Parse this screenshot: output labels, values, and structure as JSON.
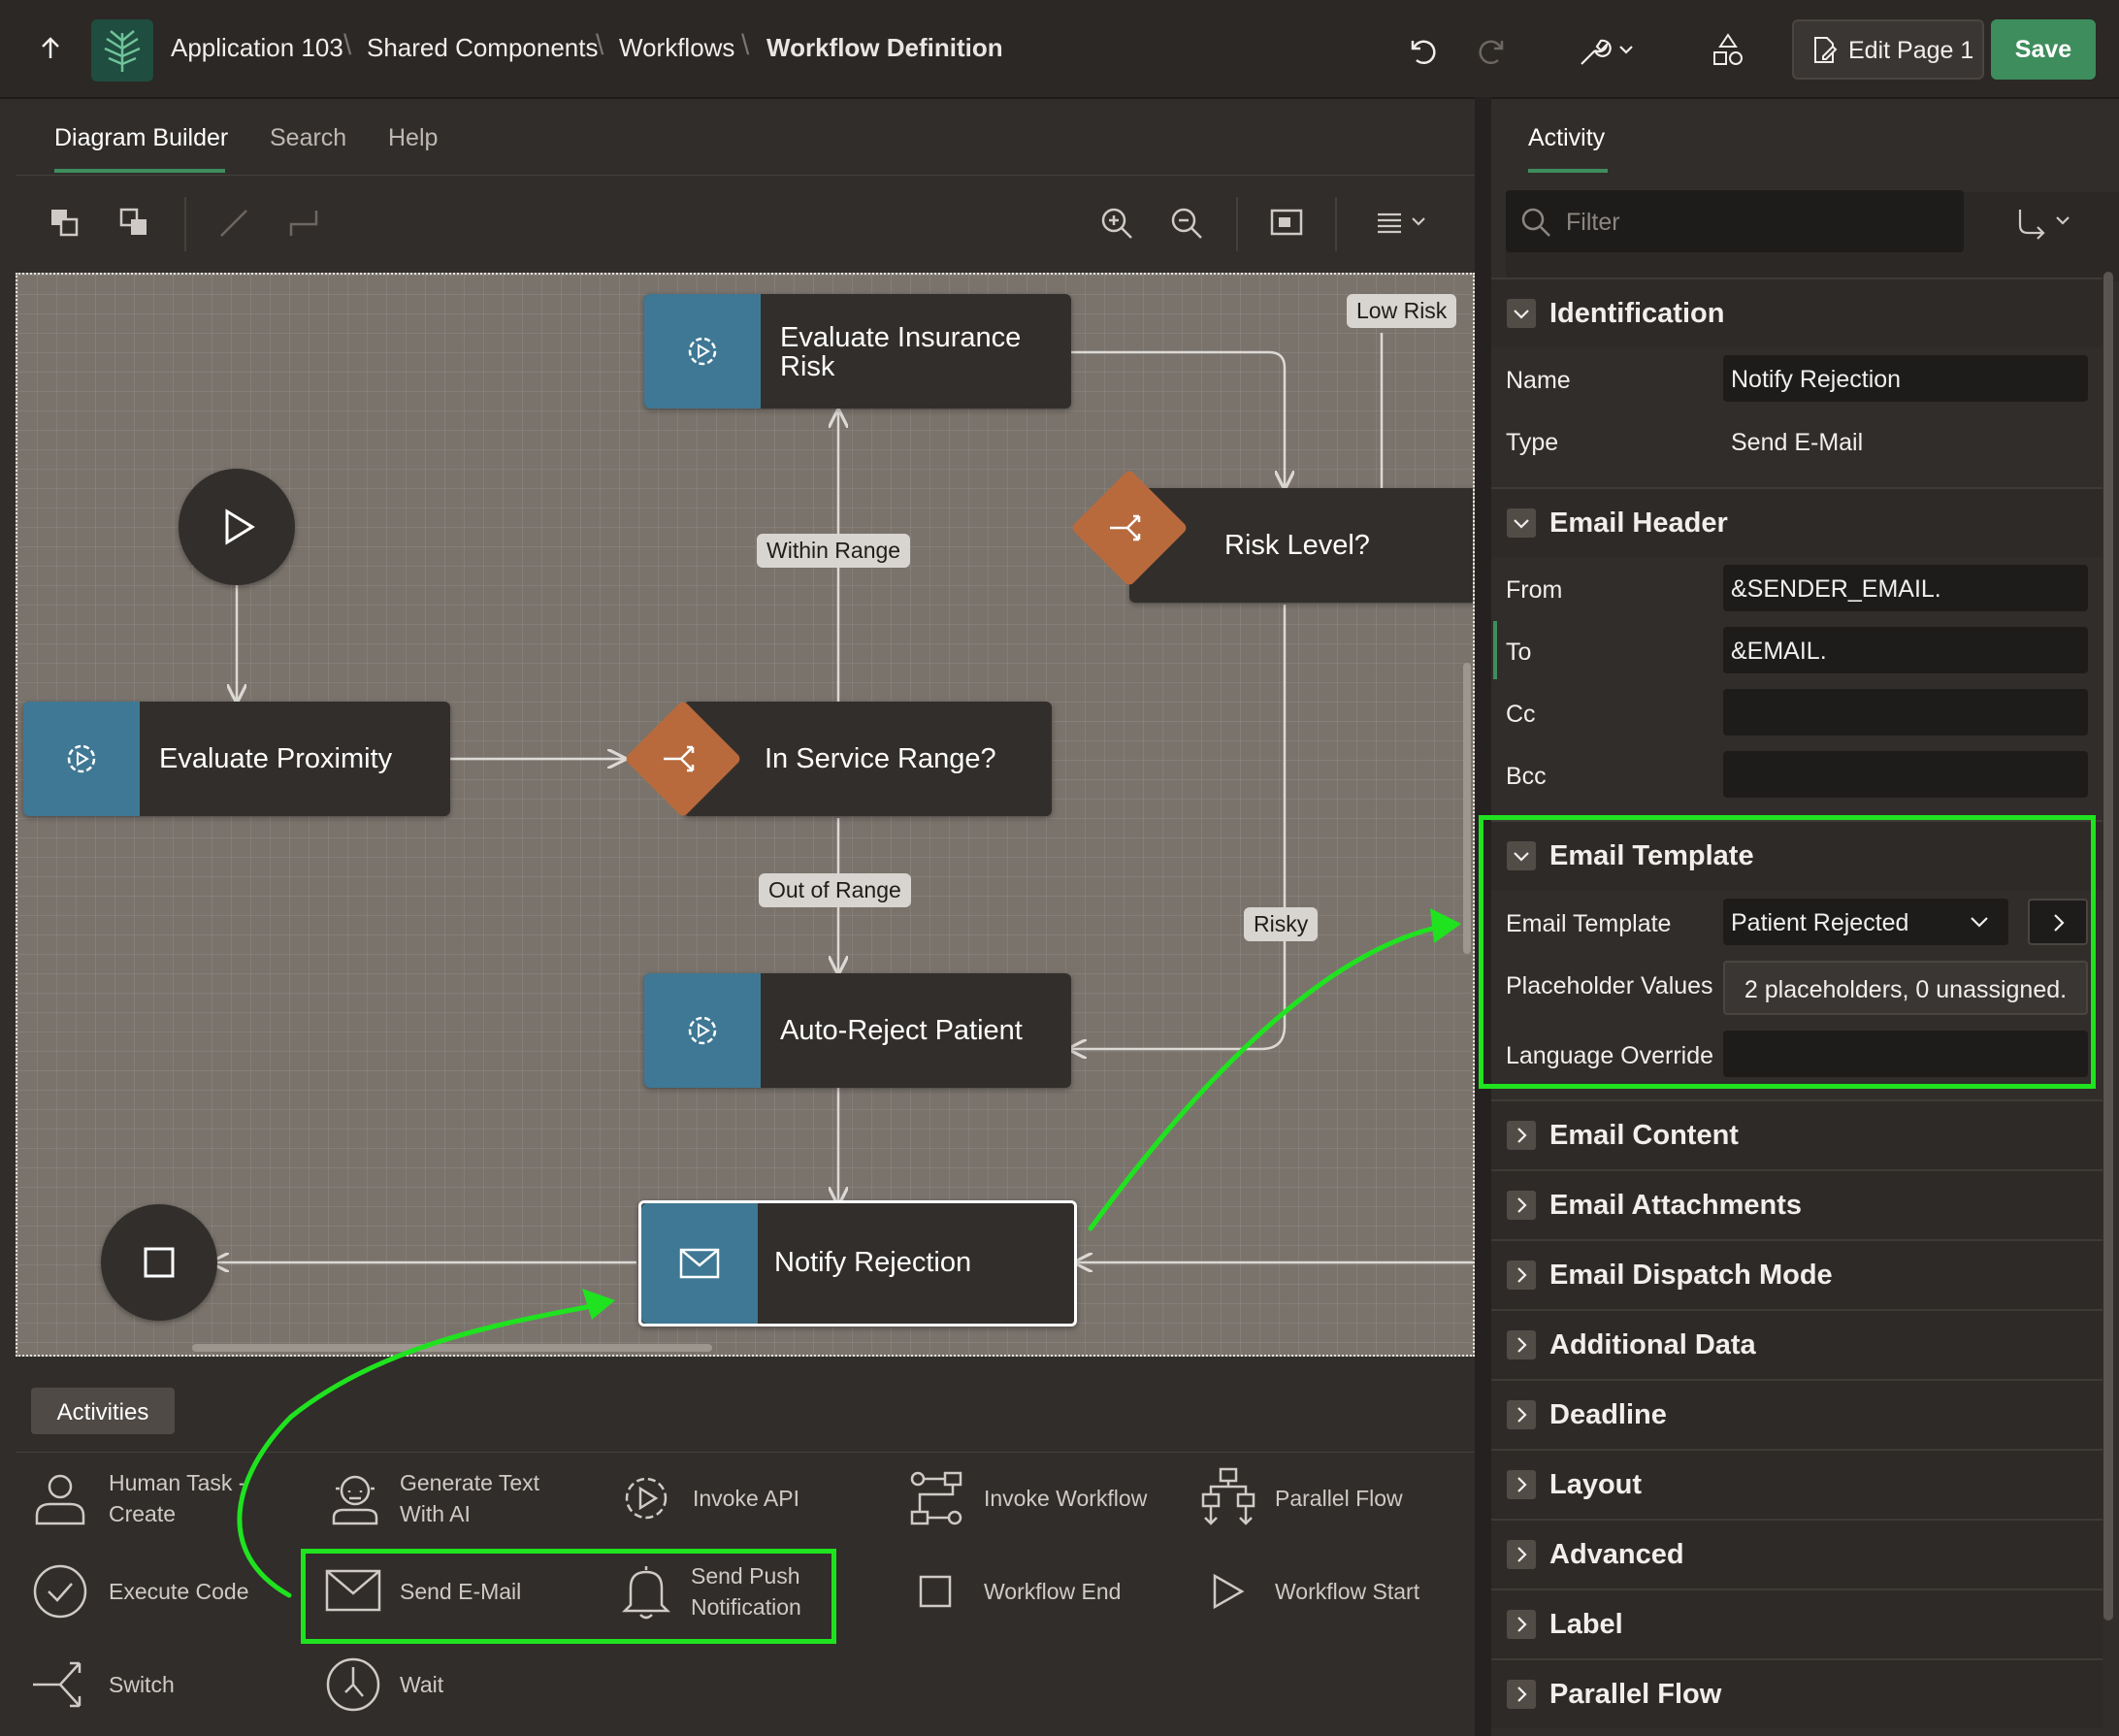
{
  "breadcrumb": {
    "items": [
      "Application 103",
      "Shared Components",
      "Workflows"
    ],
    "current": "Workflow Definition"
  },
  "toolbar": {
    "edit_label": "Edit Page 1",
    "save_label": "Save"
  },
  "left_tabs": [
    "Diagram Builder",
    "Search",
    "Help"
  ],
  "diagram": {
    "nodes": {
      "evaluate_insurance_risk": "Evaluate Insurance Risk",
      "risk_level": "Risk Level?",
      "evaluate_proximity": "Evaluate Proximity",
      "in_service_range": "In Service Range?",
      "auto_reject": "Auto-Reject Patient",
      "notify_rejection": "Notify Rejection"
    },
    "edge_labels": {
      "low_risk": "Low Risk",
      "within_range": "Within Range",
      "out_of_range": "Out of Range",
      "risky": "Risky"
    }
  },
  "activities": {
    "tab_label": "Activities",
    "items": [
      {
        "label": "Human Task -\nCreate",
        "icon": "person-icon"
      },
      {
        "label": "Generate Text\nWith AI",
        "icon": "robot-icon"
      },
      {
        "label": "Invoke API",
        "icon": "gear-play-icon"
      },
      {
        "label": "Invoke Workflow",
        "icon": "workflow-icon"
      },
      {
        "label": "Parallel Flow",
        "icon": "parallel-icon"
      },
      {
        "label": "Execute Code",
        "icon": "check-circle-icon"
      },
      {
        "label": "Send E-Mail",
        "icon": "envelope-icon"
      },
      {
        "label": "Send Push\nNotification",
        "icon": "bell-icon"
      },
      {
        "label": "Workflow End",
        "icon": "square-icon"
      },
      {
        "label": "Workflow Start",
        "icon": "triangle-play-icon"
      },
      {
        "label": "Switch",
        "icon": "switch-icon"
      },
      {
        "label": "Wait",
        "icon": "clock-icon"
      }
    ]
  },
  "right_panel": {
    "tab": "Activity",
    "filter_placeholder": "Filter",
    "sections": {
      "identification": "Identification",
      "email_header": "Email Header",
      "email_template": "Email Template",
      "collapsed": [
        "Email Content",
        "Email Attachments",
        "Email Dispatch Mode",
        "Additional Data",
        "Deadline",
        "Layout",
        "Advanced",
        "Label",
        "Parallel Flow"
      ]
    },
    "identification": {
      "name_label": "Name",
      "name_value": "Notify Rejection",
      "type_label": "Type",
      "type_value": "Send E-Mail"
    },
    "email_header": {
      "from_label": "From",
      "from_value": "&SENDER_EMAIL.",
      "to_label": "To",
      "to_value": "&EMAIL.",
      "cc_label": "Cc",
      "cc_value": "",
      "bcc_label": "Bcc",
      "bcc_value": ""
    },
    "email_template": {
      "template_label": "Email Template",
      "template_value": "Patient Rejected",
      "placeholder_label": "Placeholder Values",
      "placeholder_value": "2 placeholders, 0 unassigned.",
      "language_label": "Language Override",
      "language_value": ""
    }
  },
  "colors": {
    "accent_green": "#3e8d5d",
    "highlight_green": "#1fe31f",
    "node_blue": "#3f7894",
    "gateway_orange": "#b86a3d"
  }
}
